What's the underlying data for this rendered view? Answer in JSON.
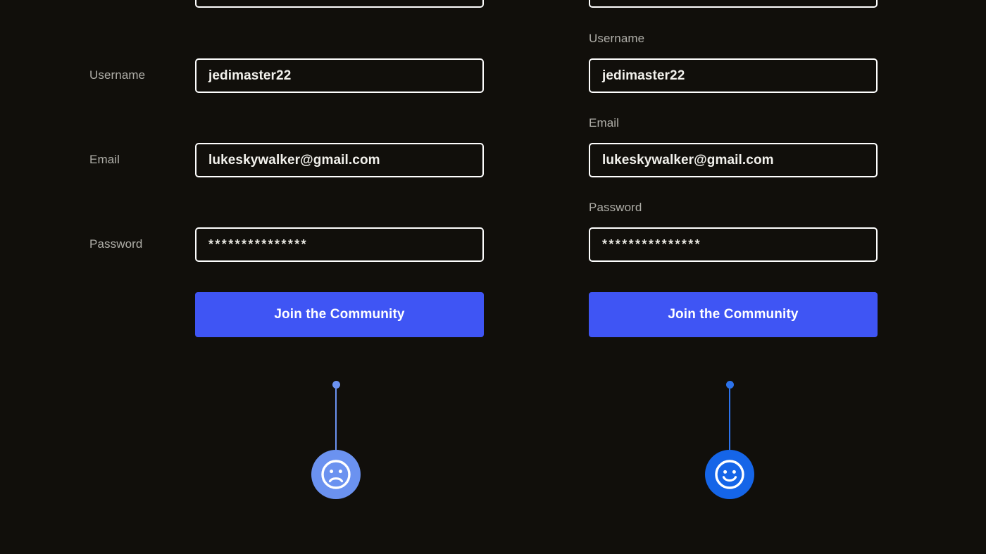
{
  "page": {
    "background_color": "#110F0B",
    "accent_color": "#3F55F4"
  },
  "variants": [
    {
      "id": "left",
      "layout": "label-left",
      "fields": [
        {
          "label": "Username",
          "value": "jedimaster22",
          "type": "text"
        },
        {
          "label": "Email",
          "value": "lukeskywalker@gmail.com",
          "type": "email"
        },
        {
          "label": "Password",
          "value": "***************",
          "type": "password"
        }
      ],
      "submit_label": "Join the Community",
      "marker": {
        "icon": "frowning-face-icon",
        "sentiment": "negative",
        "color": "#6B92F0",
        "dot_color": "#6B92F0",
        "stem_color": "#6B92F0"
      }
    },
    {
      "id": "right",
      "layout": "label-above",
      "fields": [
        {
          "label": "Username",
          "value": "jedimaster22",
          "type": "text"
        },
        {
          "label": "Email",
          "value": "lukeskywalker@gmail.com",
          "type": "email"
        },
        {
          "label": "Password",
          "value": "***************",
          "type": "password"
        }
      ],
      "submit_label": "Join the Community",
      "marker": {
        "icon": "smiling-face-icon",
        "sentiment": "positive",
        "color": "#1565E8",
        "dot_color": "#2C72EB",
        "stem_color": "#2C72EB"
      }
    }
  ]
}
